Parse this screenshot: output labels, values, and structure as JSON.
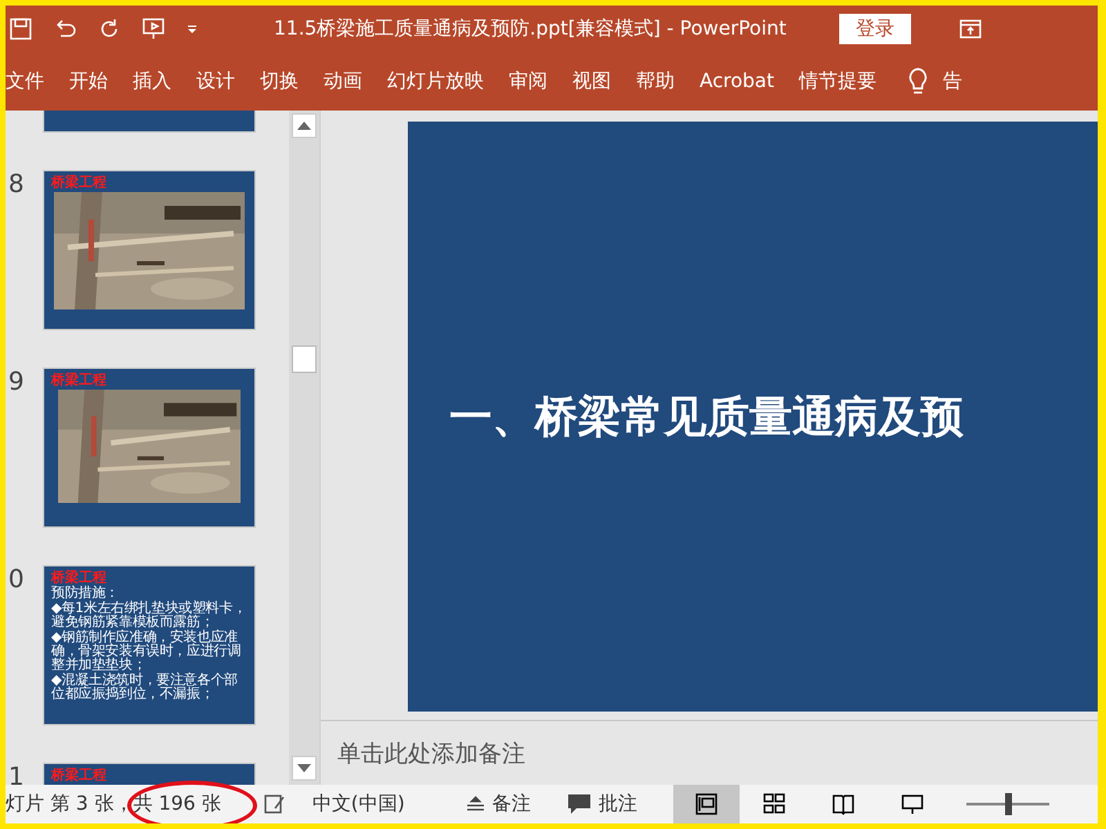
{
  "window": {
    "title": "11.5桥梁施工质量通病及预防.ppt[兼容模式]  -  PowerPoint",
    "sign_in": "登录"
  },
  "ribbon_tabs": [
    {
      "label": "文件",
      "selected": false
    },
    {
      "label": "开始",
      "selected": false
    },
    {
      "label": "插入",
      "selected": false
    },
    {
      "label": "设计",
      "selected": false
    },
    {
      "label": "切换",
      "selected": false
    },
    {
      "label": "动画",
      "selected": false
    },
    {
      "label": "幻灯片放映",
      "selected": false
    },
    {
      "label": "审阅",
      "selected": false
    },
    {
      "label": "视图",
      "selected": false
    },
    {
      "label": "帮助",
      "selected": false
    },
    {
      "label": "Acrobat",
      "selected": false
    },
    {
      "label": "情节提要",
      "selected": false
    }
  ],
  "tell_me": "告",
  "thumbnails": [
    {
      "kind": "blank"
    },
    {
      "kind": "picture",
      "number": "8",
      "heading": "桥梁工程"
    },
    {
      "kind": "picture",
      "number": "9",
      "heading": "桥梁工程"
    },
    {
      "kind": "text",
      "number": "0",
      "heading": "桥梁工程",
      "lines": [
        "预防措施：",
        "◆每1米左右绑扎垫块或塑料卡，避免钢筋紧靠模板而露筋；",
        "◆钢筋制作应准确，安装也应准确，骨架安装有误时，应进行调整并加垫垫块；",
        "◆混凝土浇筑时，要注意各个部位都应振捣到位，不漏振；"
      ]
    },
    {
      "kind": "heading",
      "number": "1",
      "heading": "桥梁工程"
    }
  ],
  "slide": {
    "title": "一、桥梁常见质量通病及预"
  },
  "notes": {
    "placeholder": "单击此处添加备注"
  },
  "status_bar": {
    "slide_info": "灯片 第 3 张，共 196 张",
    "language": "中文(中国)",
    "notes": "备注",
    "comments": "批注",
    "views": [
      {
        "kind": "normal",
        "selected": true
      },
      {
        "kind": "sorter",
        "selected": false
      },
      {
        "kind": "reading",
        "selected": false
      },
      {
        "kind": "show",
        "selected": false
      }
    ],
    "zoom": {
      "level": 0.5
    }
  }
}
